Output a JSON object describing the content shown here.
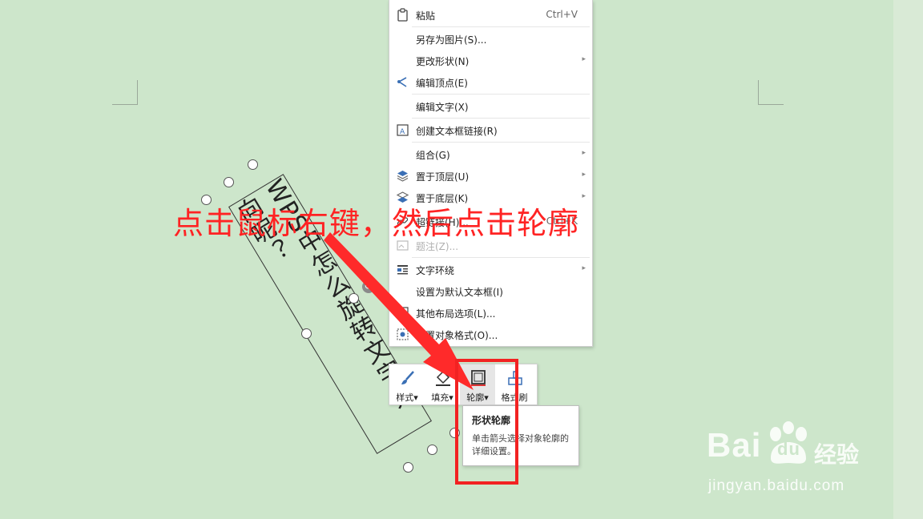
{
  "context_menu": {
    "items": [
      {
        "label": "粘贴",
        "shortcut": "Ctrl+V",
        "icon": "paste-icon"
      },
      {
        "label": "另存为图片(S)..."
      },
      {
        "label": "更改形状(N)",
        "submenu": "▸"
      },
      {
        "label": "编辑顶点(E)",
        "icon": "edit-points-icon"
      },
      {
        "label": "编辑文字(X)"
      },
      {
        "label": "创建文本框链接(R)",
        "icon": "textbox-link-icon"
      },
      {
        "label": "组合(G)",
        "submenu": "▸"
      },
      {
        "label": "置于顶层(U)",
        "submenu": "▸",
        "icon": "bring-to-front-icon"
      },
      {
        "label": "置于底层(K)",
        "submenu": "▸",
        "icon": "send-to-back-icon"
      },
      {
        "label": "超链接(H)...",
        "shortcut": "Ctrl+K",
        "icon": "hyperlink-icon"
      },
      {
        "label": "题注(Z)...",
        "icon": "caption-icon",
        "disabled": true
      },
      {
        "label": "文字环绕",
        "submenu": "▸",
        "icon": "text-wrap-icon"
      },
      {
        "label": "设置为默认文本框(I)"
      },
      {
        "label": "其他布局选项(L)...",
        "icon": "layout-options-icon"
      },
      {
        "label": "设置对象格式(O)...",
        "icon": "format-object-icon"
      }
    ]
  },
  "textbox": {
    "text": "WPS中怎么旋转文字方向呢？"
  },
  "mini_toolbar": {
    "buttons": [
      {
        "label": "样式▾",
        "icon": "brush-icon"
      },
      {
        "label": "填充▾",
        "icon": "fill-bucket-icon"
      },
      {
        "label": "轮廓▾",
        "icon": "outline-icon"
      },
      {
        "label": "格式刷",
        "icon": "format-painter-icon"
      }
    ]
  },
  "tooltip": {
    "title": "形状轮廓",
    "description": "单击箭头选择对象轮廓的详细设置。"
  },
  "annotation": {
    "text": "点击鼠标右键，然后点击轮廓",
    "color": "#ff2323"
  },
  "watermark": {
    "brand": "Bai",
    "brand_suffix": "du",
    "cn": "经验",
    "url": "jingyan.baidu.com"
  },
  "colors": {
    "page": "#cde6cb",
    "annotation": "#ff2323",
    "menu_icon": "#3a6fb5"
  }
}
